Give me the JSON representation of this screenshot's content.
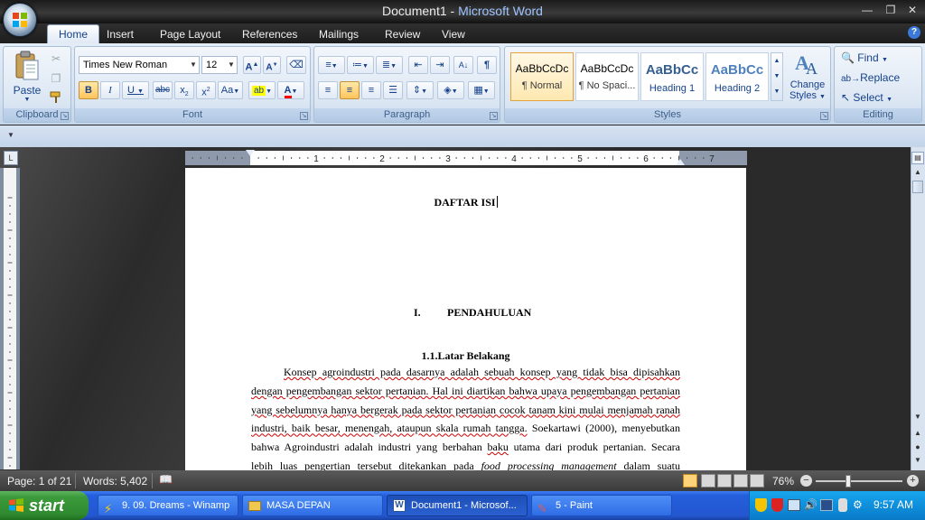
{
  "window": {
    "doc_name": "Document1",
    "app_sep": " - ",
    "app_name": "Microsoft Word"
  },
  "tabs": [
    "Home",
    "Insert",
    "Page Layout",
    "References",
    "Mailings",
    "Review",
    "View"
  ],
  "ribbon": {
    "clipboard": {
      "label": "Clipboard",
      "paste": "Paste"
    },
    "font": {
      "label": "Font",
      "family": "Times New Roman",
      "size": "12"
    },
    "paragraph": {
      "label": "Paragraph"
    },
    "styles": {
      "label": "Styles",
      "items": [
        {
          "sample": "AaBbCcDc",
          "name": "¶ Normal"
        },
        {
          "sample": "AaBbCcDc",
          "name": "¶ No Spaci..."
        },
        {
          "sample": "AaBbCc",
          "name": "Heading 1"
        },
        {
          "sample": "AaBbCc",
          "name": "Heading 2"
        }
      ],
      "change_line1": "Change",
      "change_line2": "Styles"
    },
    "editing": {
      "label": "Editing",
      "find": "Find",
      "replace": "Replace",
      "select": "Select"
    }
  },
  "ruler": {
    "numbers": [
      "1",
      "2",
      "3",
      "4",
      "5",
      "6",
      "7"
    ]
  },
  "document": {
    "title": "DAFTAR ISI",
    "chapter_num": "I.",
    "chapter_title": "PENDAHULUAN",
    "section": "1.1.Latar Belakang",
    "body_lines": [
      "Konsep agroindustri pada dasarnya adalah sebuah konsep yang tidak bisa dipisahkan",
      "dengan pengembangan sektor pertanian. Hal ini diartikan bahwa upaya pengembangan pertanian",
      "yang sebelumnya hanya bergerak pada sektor pertanian cocok tanam kini mulai menjamah ranah",
      "industri, baik besar, menengah, ataupun skala rumah tangga.",
      "Soekartawi (2000), menyebutkan",
      "bahwa Agroindustri adalah industri yang berbahan",
      "baku",
      "utama dari produk pertanian. Secara",
      "lebih luas pengertian tersebut ditekankan pada",
      "food processing management",
      "dalam suatu"
    ]
  },
  "status": {
    "page": "Page: 1 of 21",
    "words": "Words: 5,402",
    "zoom": "76%"
  },
  "taskbar": {
    "start": "start",
    "tasks": [
      "9. 09. Dreams - Winamp",
      "MASA DEPAN",
      "Document1 - Microsof...",
      "5 - Paint"
    ],
    "clock": "9:57 AM"
  },
  "colors": {
    "accent": "#15428b",
    "taskbar": "#245edb",
    "start": "#3c9a3c",
    "misspell": "#cc0000",
    "grammar": "#3a9b3a"
  }
}
